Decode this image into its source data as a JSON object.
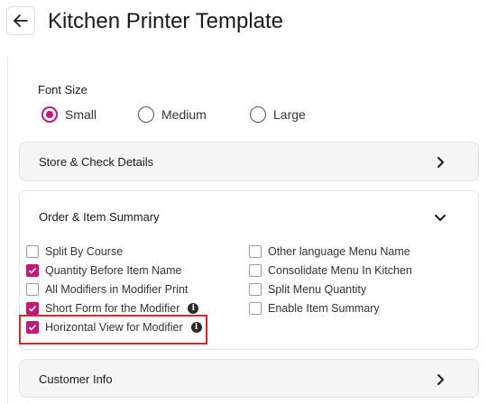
{
  "header": {
    "title": "Kitchen Printer Template"
  },
  "font_size": {
    "label": "Font Size",
    "options": [
      {
        "label": "Small",
        "checked": true
      },
      {
        "label": "Medium",
        "checked": false
      },
      {
        "label": "Large",
        "checked": false
      }
    ]
  },
  "sections": {
    "store": {
      "title": "Store & Check Details"
    },
    "order": {
      "title": "Order & Item Summary"
    },
    "customer": {
      "title": "Customer Info"
    }
  },
  "order_options": {
    "left": [
      {
        "label": "Split By Course",
        "checked": false
      },
      {
        "label": "Quantity Before Item Name",
        "checked": true
      },
      {
        "label": "All Modifiers in Modifier Print",
        "checked": false
      },
      {
        "label": "Short Form for the Modifier",
        "checked": true,
        "info": true
      },
      {
        "label": "Horizontal View for Modifier",
        "checked": true,
        "info": true
      }
    ],
    "right": [
      {
        "label": "Other language Menu Name",
        "checked": false
      },
      {
        "label": "Consolidate Menu In Kitchen",
        "checked": false
      },
      {
        "label": "Split Menu Quantity",
        "checked": false
      },
      {
        "label": "Enable Item Summary",
        "checked": false
      }
    ]
  },
  "colors": {
    "accent": "#c2187a",
    "highlight": "#e0212e"
  }
}
